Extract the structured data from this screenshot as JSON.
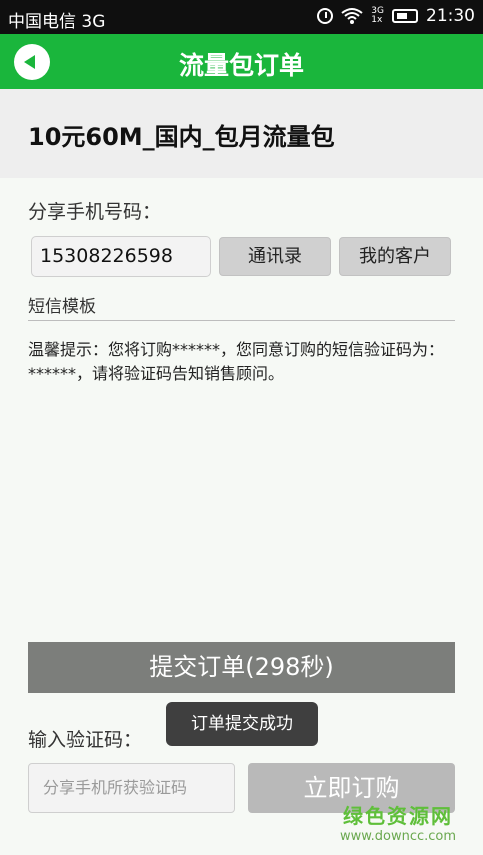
{
  "status_bar": {
    "carrier": "中国电信 3G",
    "net_top": "3G",
    "net_bottom": "1x",
    "time": "21:30",
    "icons": [
      "alarm-icon",
      "wifi-icon",
      "signal-icon",
      "battery-icon"
    ]
  },
  "header": {
    "title": "流量包订单",
    "back_icon": "back-arrow-icon",
    "color": "#1ab63c"
  },
  "product": {
    "name": "10元60M_国内_包月流量包"
  },
  "share": {
    "label": "分享手机号码：",
    "phone_value": "15308226598",
    "contacts_button": "通讯录",
    "customers_button": "我的客户"
  },
  "template": {
    "label": "短信模板",
    "tip": "温馨提示：您将订购******，您同意订购的短信验证码为：******，请将验证码告知销售顾问。"
  },
  "submit": {
    "label": "提交订单(298秒)"
  },
  "verify": {
    "label": "输入验证码：",
    "placeholder": "分享手机所获验证码",
    "order_button": "立即订购"
  },
  "toast": {
    "text": "订单提交成功"
  },
  "watermark": {
    "title": "绿色资源网",
    "url": "www.downcc.com"
  }
}
